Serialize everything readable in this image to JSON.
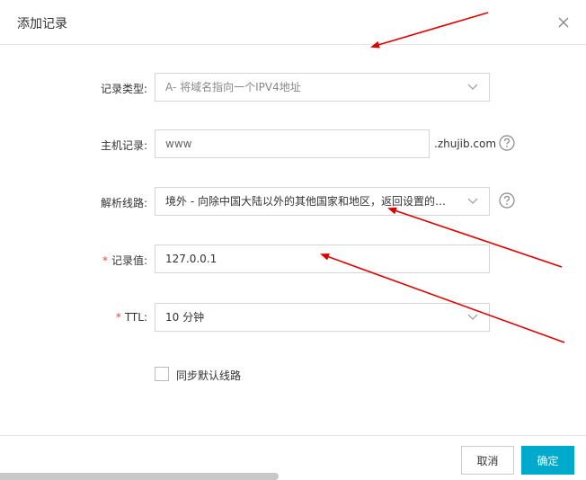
{
  "dialog": {
    "title": "添加记录",
    "close_icon": "close-icon"
  },
  "form": {
    "record_type": {
      "label": "记录类型:",
      "value": "A- 将域名指向一个IPV4地址"
    },
    "host": {
      "label": "主机记录:",
      "value": "www",
      "suffix": ".zhujib.com"
    },
    "line": {
      "label": "解析线路:",
      "value": "境外 - 向除中国大陆以外的其他国家和地区，返回设置的记..."
    },
    "record_value": {
      "required_mark": "*",
      "label": "记录值:",
      "value": "127.0.0.1"
    },
    "ttl": {
      "required_mark": "*",
      "label": "TTL:",
      "value": "10 分钟"
    },
    "sync_default": {
      "label": "同步默认线路",
      "checked": false
    }
  },
  "footer": {
    "cancel_label": "取消",
    "ok_label": "确定"
  },
  "colors": {
    "accent": "#00aacc",
    "required": "#e54545",
    "annotation_arrow": "#e00000"
  }
}
